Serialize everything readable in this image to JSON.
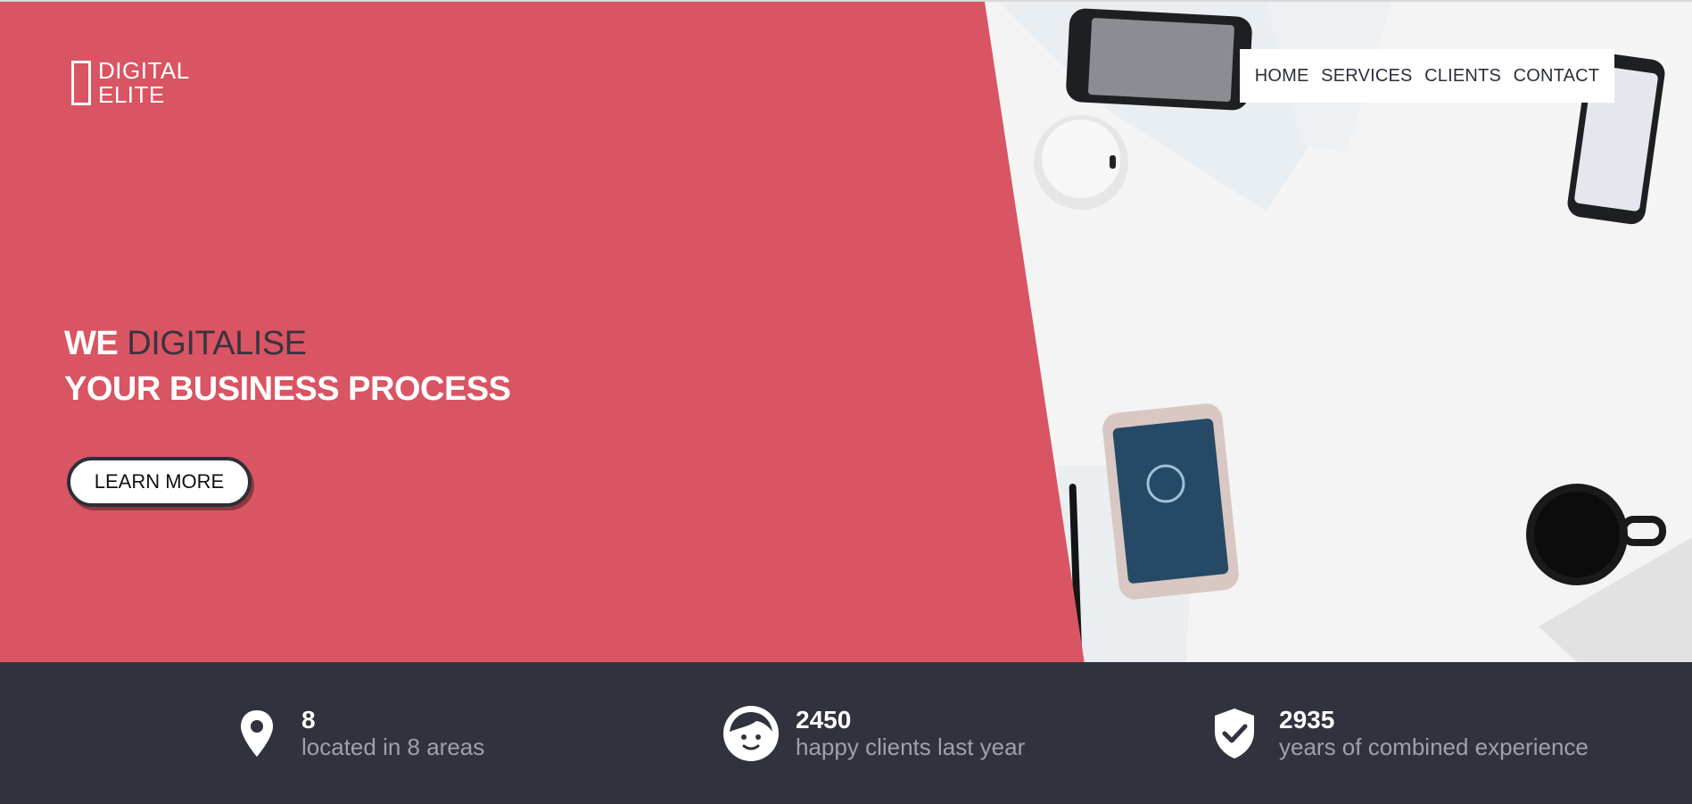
{
  "brand": {
    "name_line1": "DIGITAL",
    "name_line2": "ELITE"
  },
  "nav": {
    "items": [
      {
        "label": "HOME"
      },
      {
        "label": "SERVICES"
      },
      {
        "label": "CLIENTS"
      },
      {
        "label": "CONTACT"
      }
    ]
  },
  "hero": {
    "headline_prefix": "WE",
    "headline_accent": "DIGITALISE",
    "headline_line2": "YOUR BUSINESS PROCESS",
    "cta_label": "LEARN MORE"
  },
  "stats": [
    {
      "icon": "map-pin-icon",
      "number": "8",
      "label": "located in 8 areas"
    },
    {
      "icon": "smiley-face-icon",
      "number": "2450",
      "label": "happy clients last year"
    },
    {
      "icon": "shield-check-icon",
      "number": "2935",
      "label": "years of combined experience"
    }
  ],
  "colors": {
    "hero_red": "#d95563",
    "dark_band": "#30333d",
    "accent_text": "#3a3340",
    "muted_text": "#9ea1aa"
  }
}
